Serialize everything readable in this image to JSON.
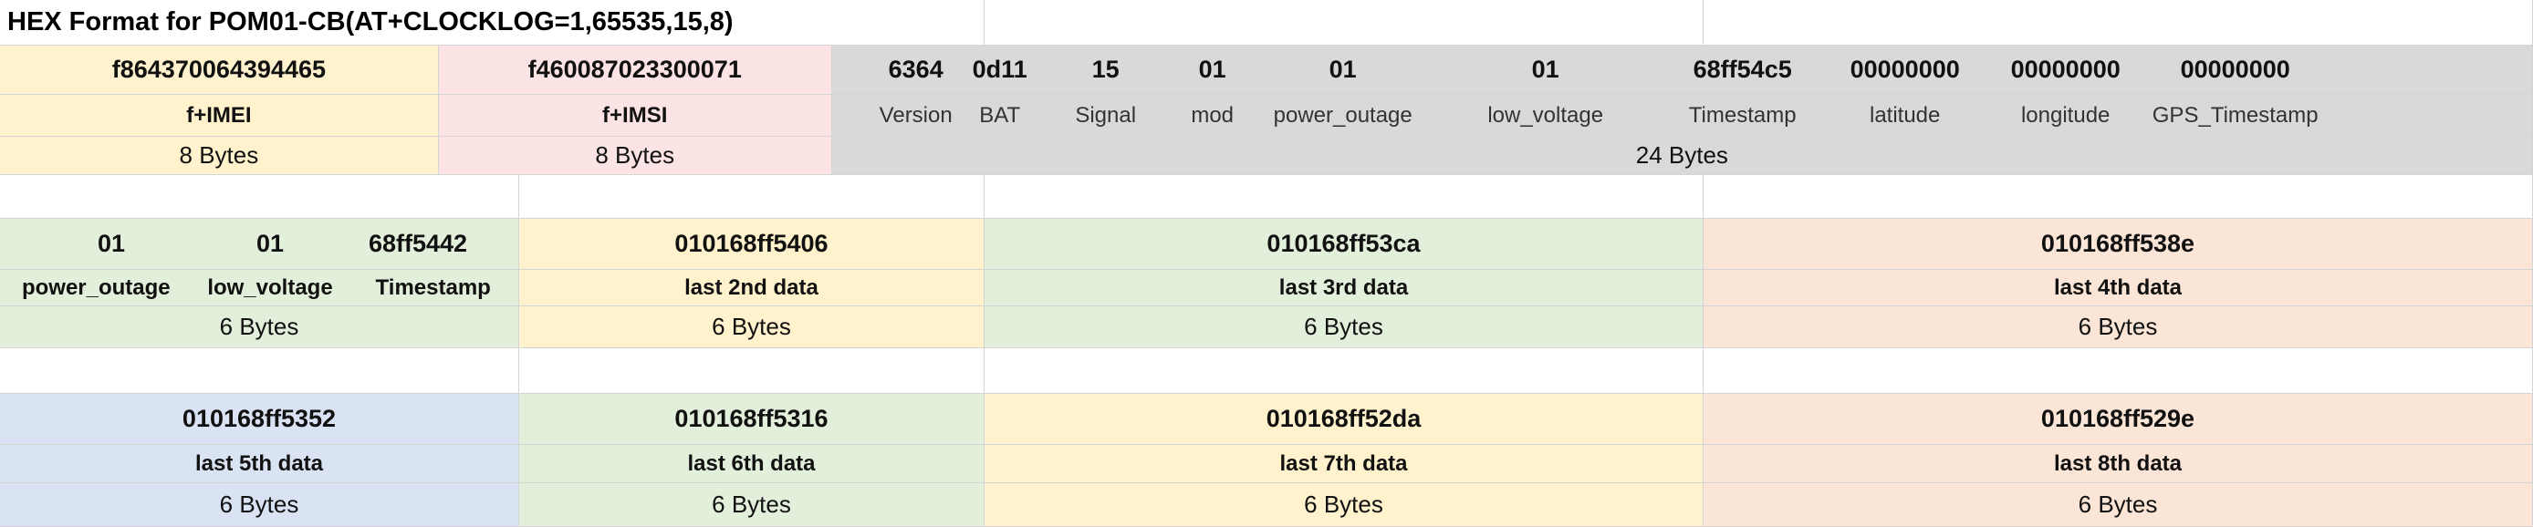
{
  "title": "HEX Format for POM01-CB(AT+CLOCKLOG=1,65535,15,8)",
  "header_block": {
    "imei": {
      "hex": "f864370064394465",
      "label": "f+IMEI",
      "size": "8 Bytes"
    },
    "imsi": {
      "hex": "f460087023300071",
      "label": "f+IMSI",
      "size": "8 Bytes"
    },
    "fields": [
      {
        "hex": "6364",
        "label": "Version"
      },
      {
        "hex": "0d11",
        "label": "BAT"
      },
      {
        "hex": "15",
        "label": "Signal"
      },
      {
        "hex": "01",
        "label": "mod"
      },
      {
        "hex": "01",
        "label": "power_outage"
      },
      {
        "hex": "01",
        "label": "low_voltage"
      },
      {
        "hex": "68ff54c5",
        "label": "Timestamp"
      },
      {
        "hex": "00000000",
        "label": "latitude"
      },
      {
        "hex": "00000000",
        "label": "longitude"
      },
      {
        "hex": "00000000",
        "label": "GPS_Timestamp"
      }
    ],
    "fields_size": "24 Bytes"
  },
  "log_row_1": {
    "first": {
      "parts": [
        {
          "hex": "01",
          "label": "power_outage"
        },
        {
          "hex": "01",
          "label": "low_voltage"
        },
        {
          "hex": "68ff5442",
          "label": "Timestamp"
        }
      ],
      "size": "6 Bytes"
    },
    "entries": [
      {
        "hex": "010168ff5406",
        "label": "last 2nd data",
        "size": "6 Bytes"
      },
      {
        "hex": "010168ff53ca",
        "label": "last 3rd data",
        "size": "6 Bytes"
      },
      {
        "hex": "010168ff538e",
        "label": "last 4th data",
        "size": "6 Bytes"
      }
    ]
  },
  "log_row_2": {
    "entries": [
      {
        "hex": "010168ff5352",
        "label": "last 5th data",
        "size": "6 Bytes"
      },
      {
        "hex": "010168ff5316",
        "label": "last 6th data",
        "size": "6 Bytes"
      },
      {
        "hex": "010168ff52da",
        "label": "last 7th data",
        "size": "6 Bytes"
      },
      {
        "hex": "010168ff529e",
        "label": "last 8th data",
        "size": "6 Bytes"
      }
    ]
  },
  "colors": {
    "yellow": "#fff2cc",
    "pink": "#fde4e4",
    "gray": "#d9d9d9",
    "green": "#e2efda",
    "peach": "#fbe5d6",
    "blue": "#dae3f3",
    "grid": "#d4d4d4"
  }
}
